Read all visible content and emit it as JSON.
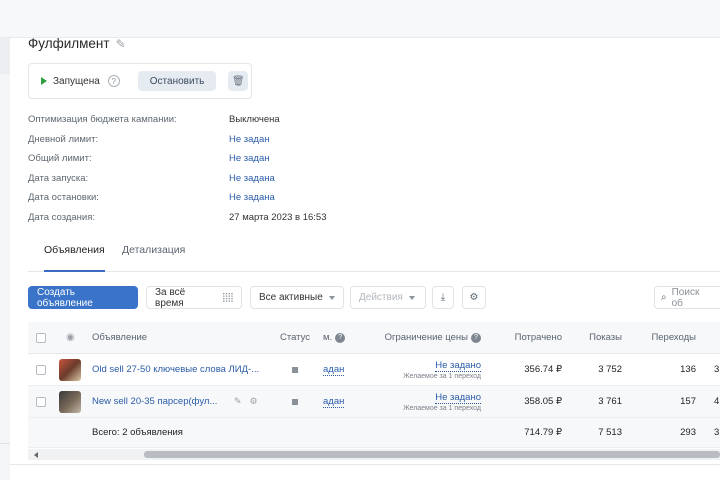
{
  "campaign": {
    "title": "Фулфилмент",
    "status": "Запущена",
    "stop_label": "Остановить"
  },
  "properties": [
    {
      "label": "Оптимизация бюджета кампании:",
      "value": "Выключена",
      "link": false
    },
    {
      "label": "Дневной лимит:",
      "value": "Не задан",
      "link": true
    },
    {
      "label": "Общий лимит:",
      "value": "Не задан",
      "link": true
    },
    {
      "label": "Дата запуска:",
      "value": "Не задана",
      "link": true
    },
    {
      "label": "Дата остановки:",
      "value": "Не задана",
      "link": true
    },
    {
      "label": "Дата создания:",
      "value": "27 марта 2023 в 16:53",
      "link": false
    }
  ],
  "tabs": [
    {
      "label": "Объявления",
      "active": true
    },
    {
      "label": "Детализация",
      "active": false
    }
  ],
  "toolbar": {
    "create_label": "Создать объявление",
    "period_label": "За всё время",
    "filter_label": "Все активные",
    "actions_label": "Действия",
    "search_placeholder": "Поиск об"
  },
  "table": {
    "headers": {
      "ad": "Объявление",
      "status": "Статус",
      "model": "м.",
      "price_limit": "Ограничение цены",
      "spent": "Потрачено",
      "impressions": "Показы",
      "clicks": "Переходы"
    },
    "rows": [
      {
        "name": "Old sell 27-50 ключевые слова ЛИД-...",
        "model": "адан",
        "limit": "Не задано",
        "limit_sub": "Желаемое за 1 переход",
        "spent": "356.74 ₽",
        "impressions": "3 752",
        "clicks": "136",
        "extra": "3"
      },
      {
        "name": "New sell 20-35 парсер(фул...",
        "model": "адан",
        "limit": "Не задано",
        "limit_sub": "Желаемое за 1 переход",
        "spent": "358.05 ₽",
        "impressions": "3 761",
        "clicks": "157",
        "extra": "4"
      }
    ],
    "total": {
      "label": "Всего: 2 объявления",
      "spent": "714.79 ₽",
      "impressions": "7 513",
      "clicks": "293",
      "extra": "3"
    }
  },
  "colors": {
    "primary": "#3a74c8",
    "link": "#2a5ca8",
    "running": "#2e9e3f"
  }
}
